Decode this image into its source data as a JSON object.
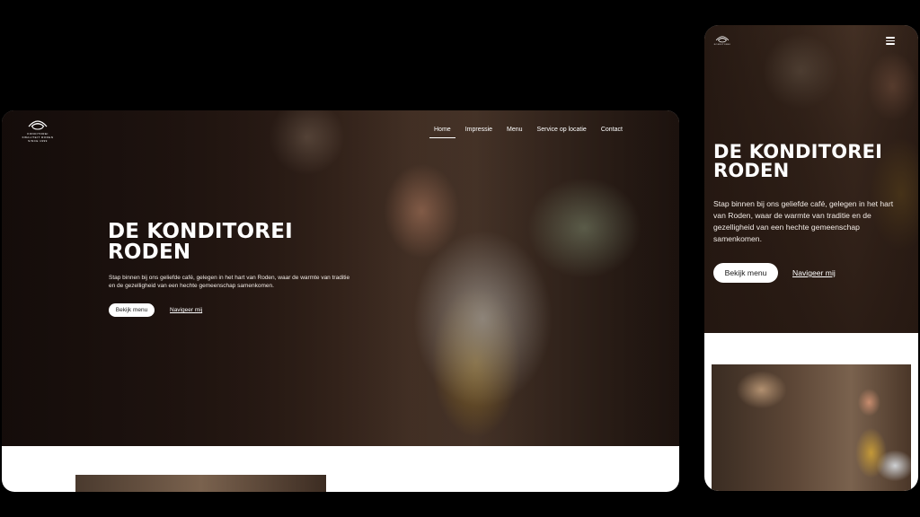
{
  "brand": {
    "logo_icon": "croissant-emblem-icon",
    "logo_line1": "KONDITOREI",
    "logo_line2": "KWALITEIT RODEN",
    "logo_line3": "SINCE 1999"
  },
  "desktop": {
    "nav": [
      {
        "label": "Home",
        "active": true
      },
      {
        "label": "Impressie",
        "active": false
      },
      {
        "label": "Menu",
        "active": false
      },
      {
        "label": "Service op locatie",
        "active": false
      },
      {
        "label": "Contact",
        "active": false
      }
    ],
    "hero": {
      "title_line1": "DE KONDITOREI",
      "title_line2": "RODEN",
      "text_line1": "Stap binnen bij ons geliefde café, gelegen in het hart van Roden, waar de warmte van traditie",
      "text_line2": "en de gezelligheid van een hechte gemeenschap samenkomen.",
      "primary_button": "Bekijk menu",
      "secondary_link": "Navigeer mij"
    }
  },
  "mobile": {
    "menu_icon": "hamburger-menu-icon",
    "hero": {
      "title_line1": "DE KONDITOREI",
      "title_line2": "RODEN",
      "text_line1": "Stap binnen bij ons geliefde café, gelegen in het hart",
      "text_line2": "van Roden, waar de warmte van traditie en de",
      "text_line3": "gezelligheid van een hechte gemeenschap",
      "text_line4": "samenkomen.",
      "primary_button": "Bekijk menu",
      "secondary_link": "Navigeer mij"
    }
  },
  "colors": {
    "background": "#000000",
    "hero_overlay": "#1f140f",
    "accent_apron": "#d4a53c",
    "button_bg": "#ffffff"
  }
}
